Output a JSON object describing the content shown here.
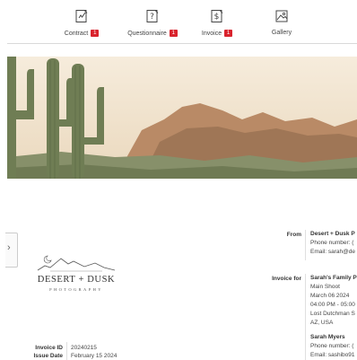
{
  "tabs": [
    {
      "label": "Contract",
      "badge": "1",
      "icon": "contract-icon"
    },
    {
      "label": "Questionnaire",
      "badge": "1",
      "icon": "questionnaire-icon"
    },
    {
      "label": "Invoice",
      "badge": "1",
      "icon": "invoice-icon"
    },
    {
      "label": "Gallery",
      "badge": "",
      "icon": "gallery-icon"
    }
  ],
  "hero": {
    "description_icon": "desert-landscape-image"
  },
  "logo": {
    "name": "DESERT + DUSK",
    "sub": "PHOTOGRAPHY"
  },
  "from": {
    "label": "From",
    "company": "Desert + Dusk P",
    "phone": "Phone number: (",
    "email": "Email: sarah@de"
  },
  "invoice_for": {
    "label": "Invoice for",
    "client": "Sarah's Family P",
    "session": "Main Shoot",
    "date": "March 06 2024",
    "time": "04:00 PM - 05:00",
    "location": "Lost Dutchman S",
    "region": "AZ, USA",
    "contact_name": "Sarah Myers",
    "contact_phone": "Phone number: (",
    "contact_email": "Email: sashibo91"
  },
  "invoice_meta": {
    "id_label": "Invoice ID",
    "id_value": "20240215",
    "issue_label": "Issue Date",
    "issue_value": "February 15 2024"
  },
  "colors": {
    "badge": "#d9232d",
    "divider": "#d9d9d9"
  }
}
